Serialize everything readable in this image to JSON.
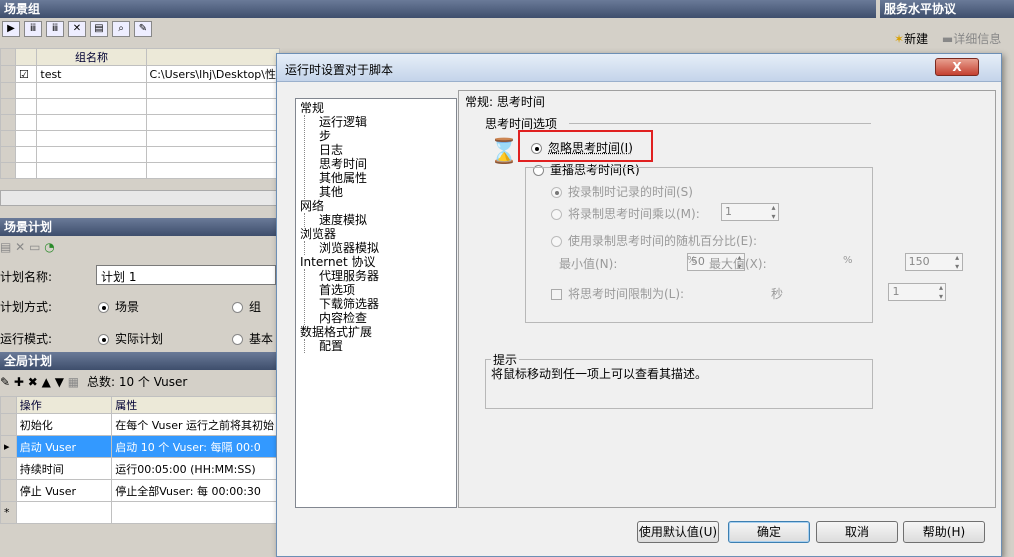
{
  "scenario_group": {
    "title": "场景组",
    "col_name": "组名称",
    "row1_name": "test",
    "row1_path": "C:\\Users\\lhj\\Desktop\\性"
  },
  "sla": {
    "title": "服务水平协议",
    "new_label": "新建",
    "detail_label": "详细信息"
  },
  "scenario_plan": {
    "title": "场景计划",
    "plan_name_label": "计划名称:",
    "plan_name_value": "计划 1",
    "plan_mode_label": "计划方式:",
    "mode_scenario": "场景",
    "mode_group": "组",
    "run_mode_label": "运行模式:",
    "run_actual": "实际计划",
    "run_basic": "基本"
  },
  "global_plan": {
    "title": "全局计划",
    "total": "总数: 10 个 Vuser",
    "col_action": "操作",
    "col_attr": "属性",
    "rows": [
      {
        "action": "初始化",
        "attr": "在每个 Vuser 运行之前将其初始"
      },
      {
        "action": "启动 Vuser",
        "attr": "启动 10 个 Vuser: 每隔 00:0"
      },
      {
        "action": "持续时间",
        "attr": "运行00:05:00 (HH:MM:SS)"
      },
      {
        "action": "停止 Vuser",
        "attr": "停止全部Vuser: 每 00:00:30"
      }
    ],
    "new_row": "*"
  },
  "dialog": {
    "title": "运行时设置对于脚本",
    "close": "X",
    "tree": {
      "general": "常规",
      "general_items": [
        "运行逻辑",
        "步",
        "日志",
        "思考时间",
        "其他属性",
        "其他"
      ],
      "network": "网络",
      "network_items": [
        "速度模拟"
      ],
      "browser": "浏览器",
      "browser_items": [
        "浏览器模拟"
      ],
      "internet": "Internet 协议",
      "internet_items": [
        "代理服务器",
        "首选项",
        "下载筛选器",
        "内容检查"
      ],
      "format": "数据格式扩展",
      "format_items": [
        "配置"
      ]
    },
    "section_title": "常规: 思考时间",
    "options_title": "思考时间选项",
    "ignore": "忽略思考时间(I)",
    "replay": "重播思考时间(R)",
    "as_recorded": "按录制时记录的时间(S)",
    "multiply": "将录制思考时间乘以(M):",
    "multiply_value": "1",
    "random": "使用录制思考时间的随机百分比(E):",
    "min_label": "最小值(N):",
    "min_value": "50",
    "max_label": "最大值(X):",
    "max_value": "150",
    "pct": "%",
    "limit": "将思考时间限制为(L):",
    "limit_value": "1",
    "sec": "秒",
    "hint_title": "提示",
    "hint_text": "将鼠标移动到任一项上可以查看其描述。",
    "btn_default": "使用默认值(U)",
    "btn_ok": "确定",
    "btn_cancel": "取消",
    "btn_help": "帮助(H)"
  },
  "highlight_color": "#e02020"
}
